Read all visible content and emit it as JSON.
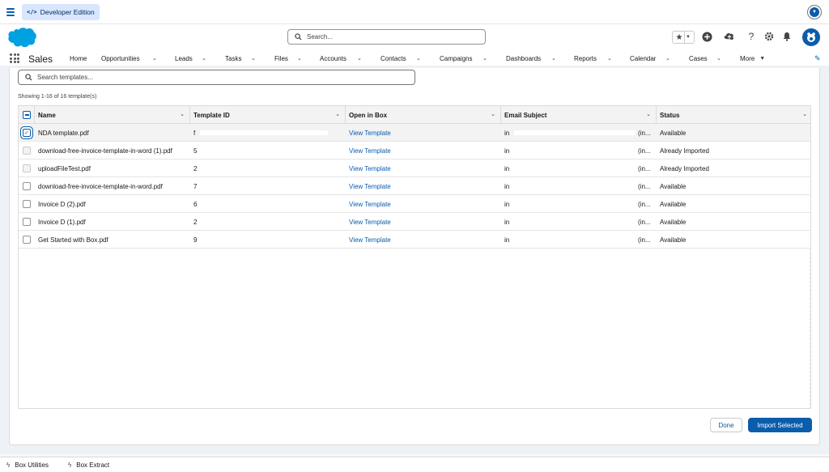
{
  "topbar": {
    "badge_label": "Developer Edition",
    "badge_code": "</>"
  },
  "header": {
    "search_placeholder": "Search..."
  },
  "nav": {
    "app_name": "Sales",
    "items": [
      {
        "label": "Home",
        "has_menu": false
      },
      {
        "label": "Opportunities",
        "has_menu": true
      },
      {
        "label": "Leads",
        "has_menu": true
      },
      {
        "label": "Tasks",
        "has_menu": true
      },
      {
        "label": "Files",
        "has_menu": true
      },
      {
        "label": "Accounts",
        "has_menu": true
      },
      {
        "label": "Contacts",
        "has_menu": true
      },
      {
        "label": "Campaigns",
        "has_menu": true
      },
      {
        "label": "Dashboards",
        "has_menu": true
      },
      {
        "label": "Reports",
        "has_menu": true
      },
      {
        "label": "Calendar",
        "has_menu": true
      },
      {
        "label": "Cases",
        "has_menu": true
      }
    ],
    "more_label": "More"
  },
  "template_search": {
    "placeholder": "Search templates..."
  },
  "showing_text": "Showing 1-16 of 16 template(s)",
  "table": {
    "columns": [
      "Name",
      "Template ID",
      "Open in Box",
      "Email Subject",
      "Status"
    ],
    "rows": [
      {
        "name": "NDA template.pdf",
        "template_id": "f",
        "open": "View Template",
        "subject": "in",
        "subject_tail": "(in...",
        "status": "Available",
        "checked": true,
        "disabled": false
      },
      {
        "name": "download-free-invoice-template-in-word (1).pdf",
        "template_id": "5",
        "open": "View Template",
        "subject": "in",
        "subject_tail": "(in...",
        "status": "Already Imported",
        "checked": false,
        "disabled": true
      },
      {
        "name": "uploadFileTest.pdf",
        "template_id": "2",
        "open": "View Template",
        "subject": "in",
        "subject_tail": "(in...",
        "status": "Already Imported",
        "checked": false,
        "disabled": true
      },
      {
        "name": "download-free-invoice-template-in-word.pdf",
        "template_id": "7",
        "open": "View Template",
        "subject": "in",
        "subject_tail": "(in...",
        "status": "Available",
        "checked": false,
        "disabled": false
      },
      {
        "name": "Invoice D (2).pdf",
        "template_id": "6",
        "open": "View Template",
        "subject": "in",
        "subject_tail": "(in...",
        "status": "Available",
        "checked": false,
        "disabled": false
      },
      {
        "name": "Invoice D (1).pdf",
        "template_id": "2",
        "open": "View Template",
        "subject": "in",
        "subject_tail": "(in...",
        "status": "Available",
        "checked": false,
        "disabled": false
      },
      {
        "name": "Get Started with Box.pdf",
        "template_id": "9",
        "open": "View Template",
        "subject": "in",
        "subject_tail": "(in...",
        "status": "Available",
        "checked": false,
        "disabled": false
      }
    ]
  },
  "buttons": {
    "done": "Done",
    "import": "Import Selected"
  },
  "utility_bar": {
    "items": [
      "Box Utilities",
      "Box Extract"
    ]
  },
  "colors": {
    "brand": "#0b5cab",
    "cloud": "#00a1e0",
    "page_bg": "#eef1f6"
  }
}
